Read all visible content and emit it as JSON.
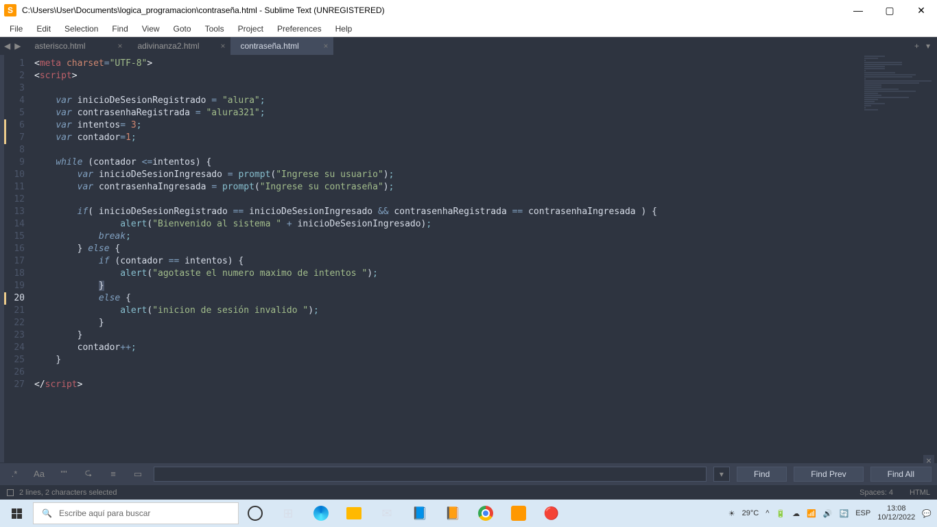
{
  "window": {
    "title": "C:\\Users\\User\\Documents\\logica_programacion\\contraseña.html - Sublime Text (UNREGISTERED)"
  },
  "menu": [
    "File",
    "Edit",
    "Selection",
    "Find",
    "View",
    "Goto",
    "Tools",
    "Project",
    "Preferences",
    "Help"
  ],
  "tabs": [
    {
      "label": "asterisco.html",
      "active": false
    },
    {
      "label": "adivinanza2.html",
      "active": false
    },
    {
      "label": "contraseña.html",
      "active": true
    }
  ],
  "find": {
    "opts": [
      ".*",
      "Aa",
      "\"\"",
      "⮎",
      "≡",
      "▭"
    ],
    "placeholder": "",
    "buttons": [
      "Find",
      "Find Prev",
      "Find All"
    ]
  },
  "status": {
    "selection": "2 lines, 2 characters selected",
    "spaces": "Spaces: 4",
    "syntax": "HTML"
  },
  "taskbar": {
    "search": "Escribe aquí para buscar",
    "temp": "29°C",
    "lang": "ESP",
    "time": "13:08",
    "date": "10/12/2022"
  },
  "code": {
    "lines": [
      1,
      2,
      3,
      4,
      5,
      6,
      7,
      8,
      9,
      10,
      11,
      12,
      13,
      14,
      15,
      16,
      17,
      18,
      19,
      20,
      21,
      22,
      23,
      24,
      25,
      26,
      27
    ],
    "active_line": 20,
    "modified_lines": [
      6,
      7,
      20
    ]
  }
}
